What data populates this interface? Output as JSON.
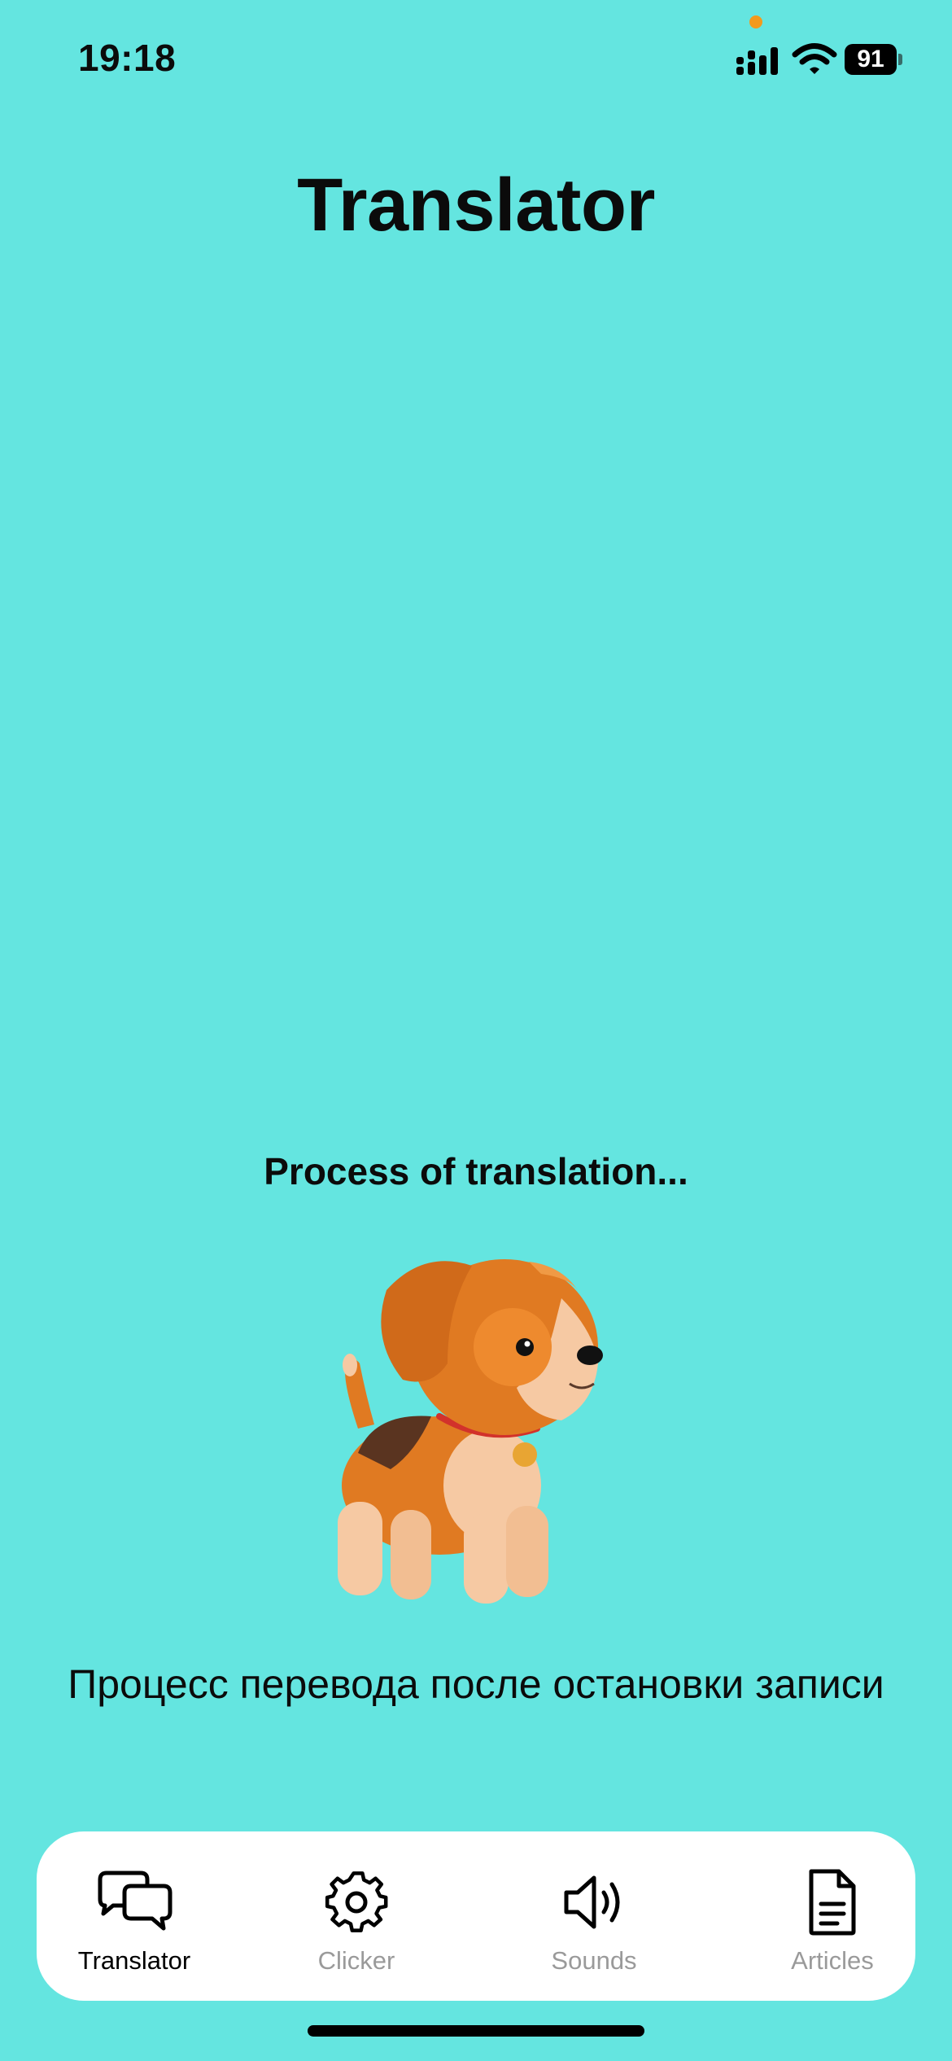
{
  "status_bar": {
    "time": "19:18",
    "battery_level": "91"
  },
  "page": {
    "title": "Translator",
    "process_label": "Process of translation...",
    "description": "Процесс перевода после остановки записи"
  },
  "tabs": [
    {
      "label": "Translator",
      "icon": "chat-bubbles-icon",
      "active": true
    },
    {
      "label": "Clicker",
      "icon": "gear-icon",
      "active": false
    },
    {
      "label": "Sounds",
      "icon": "speaker-icon",
      "active": false
    },
    {
      "label": "Articles",
      "icon": "document-icon",
      "active": false
    }
  ],
  "colors": {
    "background": "#64E5E0",
    "tab_bar": "#FFFFFF",
    "active_tab": "#000000",
    "inactive_tab": "#9A9A9A",
    "privacy_dot": "#F39A1C"
  }
}
